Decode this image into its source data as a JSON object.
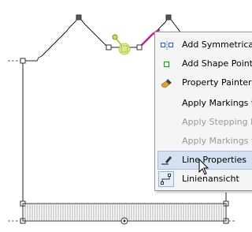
{
  "context_menu": {
    "items": [
      {
        "label": "Add Symmetrical S",
        "icon": "symmetrical-points-icon",
        "state": "normal"
      },
      {
        "label": "Add Shape Point",
        "icon": "shape-point-icon",
        "state": "normal"
      },
      {
        "label": "Property Painter",
        "icon": "paint-brush-icon",
        "state": "normal"
      },
      {
        "label": "Apply Markings to",
        "icon": "",
        "state": "normal"
      },
      {
        "label": "Apply Stepping Pa",
        "icon": "",
        "state": "disabled"
      },
      {
        "label": "Apply Markings to",
        "icon": "",
        "state": "disabled"
      },
      {
        "label": "Line Properties",
        "icon": "line-edit-icon",
        "state": "highlighted"
      },
      {
        "label": "Linienansicht",
        "icon": "line-view-icon",
        "state": "checked"
      }
    ]
  },
  "colors": {
    "selected_segment": "#c0288c",
    "point_handle": "#9ac01a",
    "menu_highlight": "#d5e1f2"
  }
}
